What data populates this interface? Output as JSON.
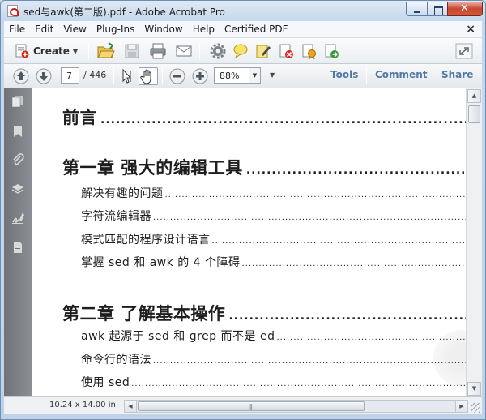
{
  "window": {
    "title": "sed与awk(第二版).pdf - Adobe Acrobat Pro"
  },
  "menu": [
    "File",
    "Edit",
    "View",
    "Plug-Ins",
    "Window",
    "Help",
    "Certified PDF"
  ],
  "toolbar": {
    "create_label": "Create",
    "icons": [
      "open-folder-icon",
      "save-icon",
      "print-icon",
      "email-icon",
      "gear-icon",
      "comment-bubble-icon",
      "sign-pen-icon",
      "secure-lock-icon",
      "certificate-icon",
      "export-icon"
    ]
  },
  "navigation": {
    "current_page": "7",
    "total_pages": "/ 446",
    "zoom": "88%"
  },
  "panes": {
    "tools": "Tools",
    "comment": "Comment",
    "share": "Share"
  },
  "status": {
    "page_size": "10.24 x 14.00 in"
  },
  "toc": [
    {
      "level": 1,
      "text": "前言"
    },
    {
      "level": 1,
      "text": "第一章 强大的编辑工具"
    },
    {
      "level": 2,
      "text": "解决有趣的问题"
    },
    {
      "level": 2,
      "text": "字符流编辑器"
    },
    {
      "level": 2,
      "text": "模式匹配的程序设计语言"
    },
    {
      "level": 2,
      "text": "掌握 sed 和 awk 的 4 个障碍"
    },
    {
      "level": 1,
      "text": "第二章 了解基本操作"
    },
    {
      "level": 2,
      "text": "awk 起源于 sed 和 grep 而不是 ed"
    },
    {
      "level": 2,
      "text": "命令行的语法"
    },
    {
      "level": 2,
      "text": "使用 sed"
    }
  ],
  "colors": {
    "pane_link": "#4e78a5",
    "nav_panel": "#7b7f84",
    "frame": "#c6d8ec"
  }
}
